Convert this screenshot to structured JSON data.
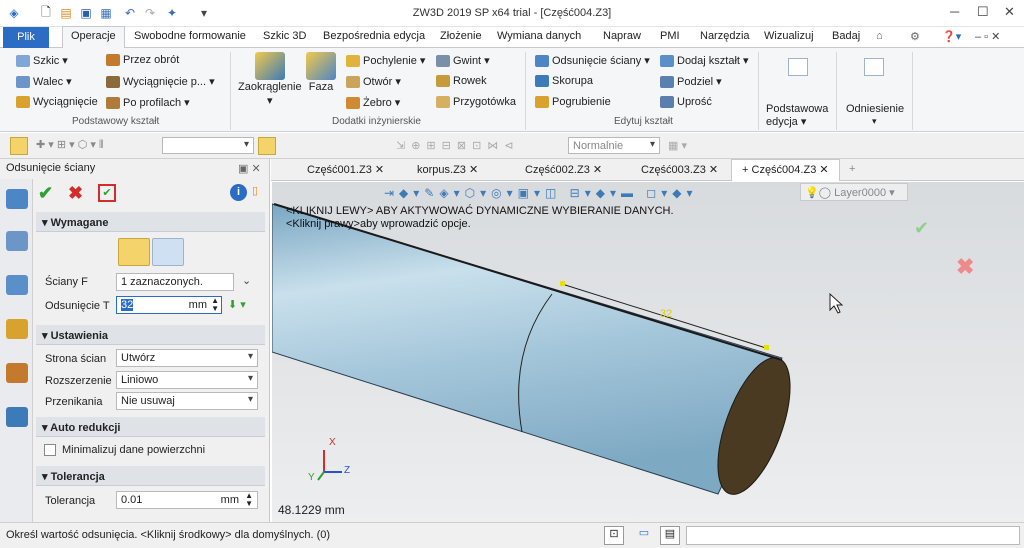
{
  "window": {
    "title": "ZW3D 2019 SP x64 trial - [Część004.Z3]"
  },
  "tabs": [
    "Plik",
    "Operacje",
    "Swobodne formowanie",
    "Szkic 3D",
    "Bezpośrednia edycja",
    "Złożenie",
    "Wymiana danych",
    "Napraw",
    "PMI",
    "Narzędzia",
    "Wizualizuj",
    "Badaj"
  ],
  "ribbon": {
    "basic": [
      "Szkic",
      "Walec",
      "Wyciągnięcie",
      "Przez obrót",
      "Wyciągnięcie p...",
      "Po profilach"
    ],
    "basic_group": "Podstawowy kształt",
    "large": [
      "Zaokrąglenie",
      "Faza"
    ],
    "eng": [
      "Pochylenie",
      "Otwór",
      "Żebro",
      "Gwint",
      "Rowek",
      "Przygotówka"
    ],
    "eng_group": "Dodatki inżynierskie",
    "edit": [
      "Odsunięcie ściany",
      "Skorupa",
      "Pogrubienie",
      "Dodaj kształt",
      "Podziel",
      "Uprość"
    ],
    "edit_group": "Edytuj kształt",
    "base_edit": "Podstawowa edycja",
    "reference": "Odniesienie"
  },
  "toolbar2": {
    "style": "Normalnie"
  },
  "panel": {
    "title": "Odsunięcie ściany",
    "required": "Wymagane",
    "faces_label": "Ściany F",
    "faces_value": "1 zaznaczonych.",
    "offset_label": "Odsunięcie T",
    "offset_value": "32",
    "offset_unit": "mm",
    "settings": "Ustawienia",
    "side_label": "Strona ścian",
    "side_value": "Utwórz",
    "ext_label": "Rozszerzenie",
    "ext_value": "Liniowo",
    "int_label": "Przenikania",
    "int_value": "Nie usuwaj",
    "auto": "Auto redukcji",
    "minimize": "Minimalizuj dane powierzchni",
    "tolerance": "Tolerancja",
    "tol_label": "Tolerancja",
    "tol_value": "0.01",
    "tol_unit": "mm"
  },
  "doctabs": [
    "Część001.Z3",
    "korpus.Z3",
    "Część002.Z3",
    "Część003.Z3",
    "Część004.Z3"
  ],
  "viewport": {
    "hint1": "<KLIKNIJ LEWY> ABY AKTYWOWAĆ DYNAMICZNE WYBIERANIE DANYCH.",
    "hint2": "<Kliknij prawy>aby wprowadzić opcje.",
    "layer": "Layer0000",
    "measure": "48.1229 mm",
    "dim": "32",
    "axes": {
      "x": "X",
      "y": "Y",
      "z": "Z"
    }
  },
  "status": {
    "text": "Określ wartość odsunięcia.   <Kliknij środkowy> dla domyślnych. (0)"
  },
  "colors": {
    "accent": "#2b6cc4",
    "cylinder": "#a9c9db",
    "cap": "#4a3a22"
  }
}
